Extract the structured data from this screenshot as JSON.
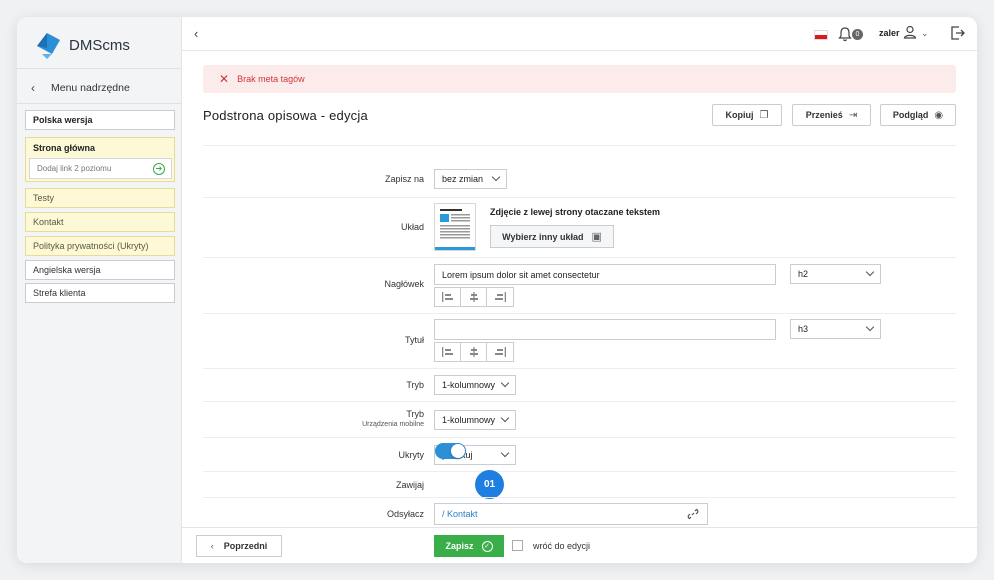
{
  "app": {
    "name": "DMScms"
  },
  "sidebar": {
    "back_label": "Menu nadrzędne",
    "items": [
      {
        "label": "Polska wersja"
      },
      {
        "label": "Strona główna"
      },
      {
        "label": "Testy"
      },
      {
        "label": "Kontakt"
      },
      {
        "label": "Polityka prywatności (Ukryty)"
      },
      {
        "label": "Angielska wersja"
      },
      {
        "label": "Strefa klienta"
      }
    ],
    "add_link_placeholder": "Dodaj link 2 poziomu"
  },
  "topbar": {
    "notification_count": "0",
    "user_name": "zaler"
  },
  "alert": {
    "text": "Brak meta tagów"
  },
  "page": {
    "title": "Podstrona opisowa - edycja"
  },
  "toolbar": {
    "copy_label": "Kopiuj",
    "move_label": "Przenieś",
    "preview_label": "Podgląd"
  },
  "form": {
    "save_to": {
      "label": "Zapisz na",
      "value": "bez zmian"
    },
    "layout": {
      "label": "Układ",
      "name": "Zdjęcie z lewej strony otaczane tekstem",
      "button": "Wybierz inny układ"
    },
    "heading": {
      "label": "Nagłówek",
      "value": "Lorem ipsum dolor sit amet consectetur",
      "tag": "h2"
    },
    "title": {
      "label": "Tytuł",
      "value": "",
      "tag": "h3"
    },
    "mode": {
      "label": "Tryb",
      "value": "1-kolumnowy"
    },
    "mode_mobile": {
      "label": "Tryb",
      "sublabel": "Urządzenia mobilne",
      "value": "1-kolumnowy"
    },
    "hidden": {
      "label": "Ukryty",
      "value": "publikuj"
    },
    "wrap": {
      "label": "Zawijaj",
      "on": true,
      "step_badge": "01"
    },
    "redirect": {
      "label": "Odsyłacz",
      "value": "/ Kontakt"
    }
  },
  "footer": {
    "prev_label": "Poprzedni",
    "save_label": "Zapisz",
    "return_label": "wróć do edycji"
  },
  "colors": {
    "accent": "#2d8fd6",
    "save": "#3aae49",
    "alert": "#d2353a",
    "highlight": "#fdf8d5"
  }
}
